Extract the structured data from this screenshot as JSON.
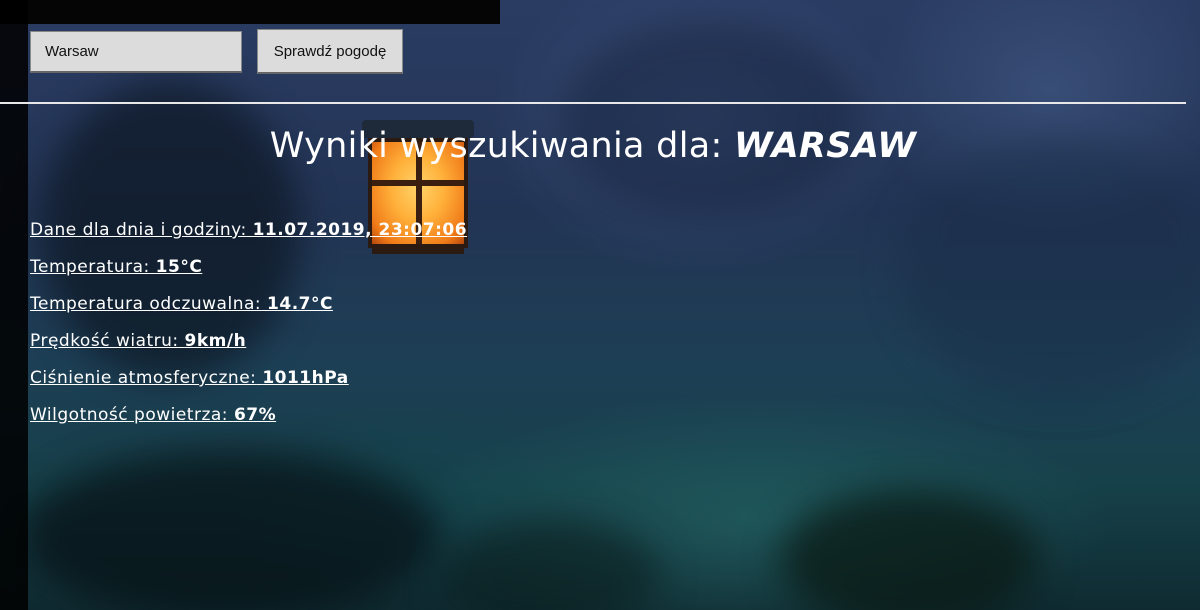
{
  "search": {
    "value": "Warsaw",
    "button_label": "Sprawdź pogodę"
  },
  "header": {
    "title_prefix": "Wyniki wyszukiwania dla:",
    "city": "WARSAW"
  },
  "results": [
    {
      "label": "Dane dla dnia i godziny:",
      "value": "11.07.2019, 23:07:06"
    },
    {
      "label": "Temperatura:",
      "value": "15°C"
    },
    {
      "label": "Temperatura odczuwalna:",
      "value": "14.7°C"
    },
    {
      "label": "Prędkość wiatru:",
      "value": "9km/h"
    },
    {
      "label": "Ciśnienie atmosferyczne:",
      "value": "1011hPa"
    },
    {
      "label": "Wilgotność powietrza:",
      "value": "67%"
    }
  ]
}
